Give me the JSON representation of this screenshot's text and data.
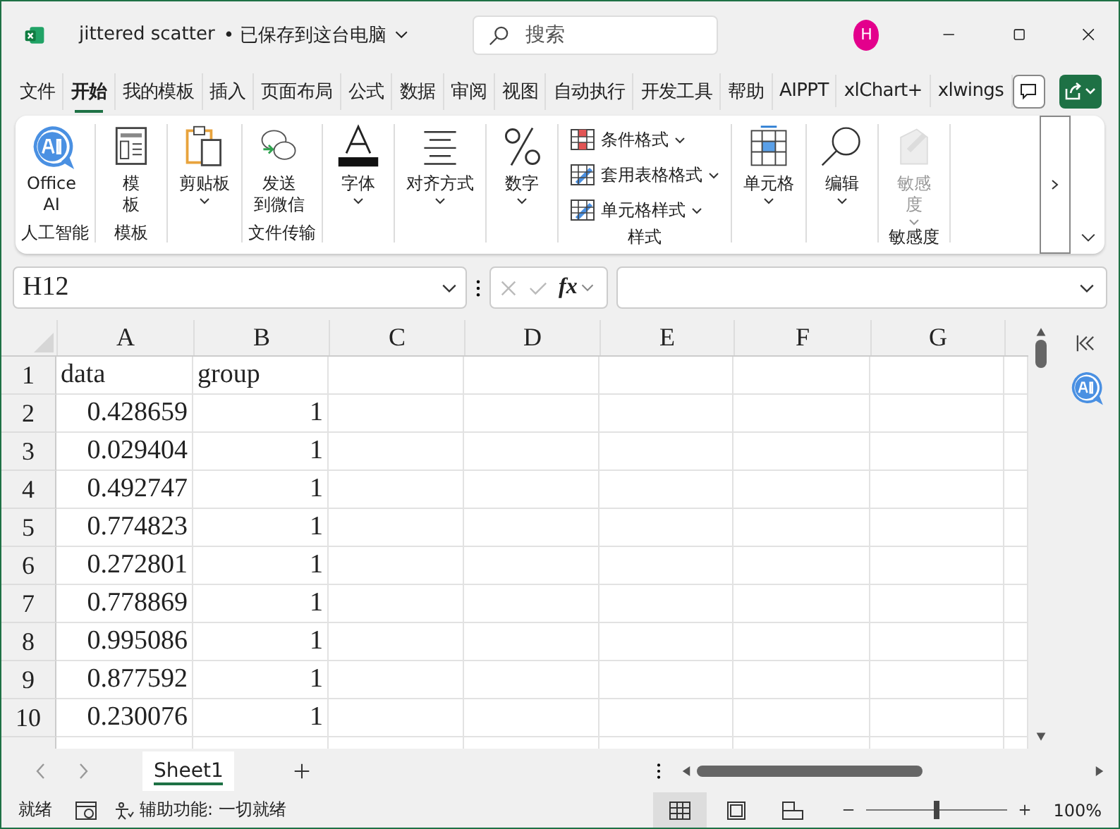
{
  "window": {
    "title": "jittered scatter",
    "save_status": "• 已保存到这台电脑",
    "search_placeholder": "搜索",
    "avatar": "H"
  },
  "tabs": [
    {
      "label": "文件",
      "selected": false
    },
    {
      "label": "开始",
      "selected": true
    },
    {
      "label": "我的模板",
      "selected": false
    },
    {
      "label": "插入",
      "selected": false
    },
    {
      "label": "页面布局",
      "selected": false
    },
    {
      "label": "公式",
      "selected": false
    },
    {
      "label": "数据",
      "selected": false
    },
    {
      "label": "审阅",
      "selected": false
    },
    {
      "label": "视图",
      "selected": false
    },
    {
      "label": "自动执行",
      "selected": false
    },
    {
      "label": "开发工具",
      "selected": false
    },
    {
      "label": "帮助",
      "selected": false
    },
    {
      "label": "AIPPT",
      "selected": false
    },
    {
      "label": "xlChart+",
      "selected": false
    },
    {
      "label": "xlwings",
      "selected": false
    }
  ],
  "ribbon": [
    {
      "label": "人工智能",
      "items": [
        {
          "kind": "large",
          "lines": [
            "Office",
            "AI"
          ],
          "caret": false,
          "disabled": false
        }
      ]
    },
    {
      "label": "模板",
      "items": [
        {
          "kind": "large",
          "lines": [
            "模",
            "板"
          ],
          "caret": false,
          "disabled": false
        }
      ]
    },
    {
      "items": [
        {
          "kind": "large",
          "lines": [
            "剪贴板"
          ],
          "caret": true,
          "disabled": false
        }
      ]
    },
    {
      "label": "文件传输",
      "items": [
        {
          "kind": "large",
          "lines": [
            "发送",
            "到微信"
          ],
          "caret": false,
          "disabled": false
        }
      ]
    },
    {
      "items": [
        {
          "kind": "large",
          "lines": [
            "字体"
          ],
          "caret": true,
          "disabled": false
        }
      ]
    },
    {
      "items": [
        {
          "kind": "large",
          "lines": [
            "对齐方式"
          ],
          "caret": true,
          "disabled": false
        }
      ]
    },
    {
      "items": [
        {
          "kind": "large",
          "lines": [
            "数字"
          ],
          "caret": true,
          "disabled": false
        }
      ]
    },
    {
      "label": "样式",
      "items": [
        {
          "kind": "small",
          "lines": [
            "条件格式"
          ],
          "caret": true
        },
        {
          "kind": "small",
          "lines": [
            "套用表格格式"
          ],
          "caret": true
        },
        {
          "kind": "small",
          "lines": [
            "单元格样式"
          ],
          "caret": true
        }
      ]
    },
    {
      "items": [
        {
          "kind": "large",
          "lines": [
            "单元格"
          ],
          "caret": true,
          "disabled": false
        }
      ]
    },
    {
      "items": [
        {
          "kind": "large",
          "lines": [
            "编辑"
          ],
          "caret": true,
          "disabled": false
        }
      ]
    },
    {
      "label": "敏感度",
      "items": [
        {
          "kind": "large",
          "lines": [
            "敏感",
            "度"
          ],
          "caret": true,
          "disabled": true
        }
      ]
    }
  ],
  "name_box": "H12",
  "formula_symbol": "fx",
  "columns": [
    "A",
    "B",
    "C",
    "D",
    "E",
    "F",
    "G"
  ],
  "rows": [
    {
      "number": "1",
      "cells": [
        "data",
        "group"
      ]
    },
    {
      "number": "2",
      "cells": [
        "0.428659",
        "1"
      ]
    },
    {
      "number": "3",
      "cells": [
        "0.029404",
        "1"
      ]
    },
    {
      "number": "4",
      "cells": [
        "0.492747",
        "1"
      ]
    },
    {
      "number": "5",
      "cells": [
        "0.774823",
        "1"
      ]
    },
    {
      "number": "6",
      "cells": [
        "0.272801",
        "1"
      ]
    },
    {
      "number": "7",
      "cells": [
        "0.778869",
        "1"
      ]
    },
    {
      "number": "8",
      "cells": [
        "0.995086",
        "1"
      ]
    },
    {
      "number": "9",
      "cells": [
        "0.877592",
        "1"
      ]
    },
    {
      "number": "10",
      "cells": [
        "0.230076",
        "1"
      ]
    }
  ],
  "sheets": [
    {
      "label": "Sheet1",
      "selected": true
    }
  ],
  "status": {
    "ready": "就绪",
    "accessibility": "辅助功能: 一切就绪",
    "zoom": {
      "level": 0.5,
      "reading": "100%"
    },
    "views": [
      {
        "selected": true
      },
      {
        "selected": false
      },
      {
        "selected": false
      }
    ]
  }
}
